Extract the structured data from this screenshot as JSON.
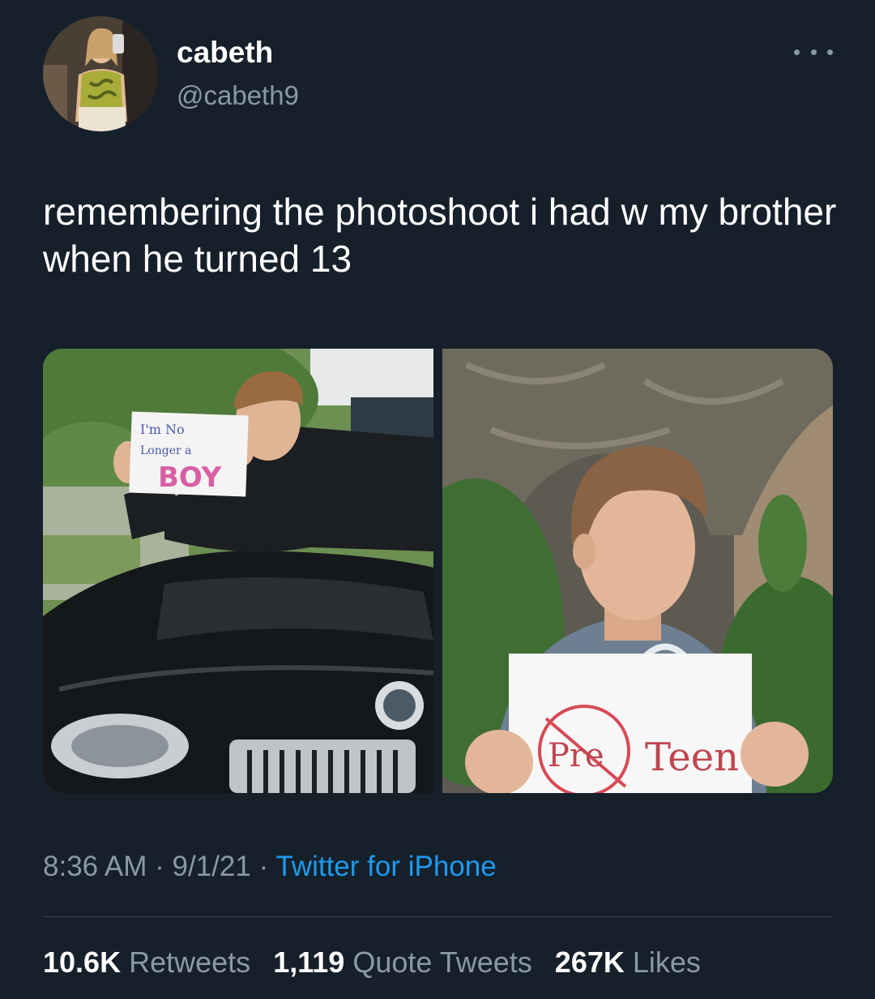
{
  "author": {
    "display_name": "cabeth",
    "handle": "@cabeth9",
    "avatar_icon": "profile-photo",
    "more_icon": "more-horizontal-icon"
  },
  "tweet": {
    "text": "remembering the photoshoot i had w my brother when he turned 13",
    "media": [
      {
        "sign_text": "I'm No Longer a BOY"
      },
      {
        "sign_text": "Pre Teen"
      }
    ],
    "time": "8:36 AM",
    "date": "9/1/21",
    "separator": "·",
    "source": "Twitter for iPhone"
  },
  "stats": {
    "retweets_count": "10.6K",
    "retweets_label": "Retweets",
    "quotes_count": "1,119",
    "quotes_label": "Quote Tweets",
    "likes_count": "267K",
    "likes_label": "Likes"
  },
  "colors": {
    "background": "#15202b",
    "secondary_text": "#8b98a5",
    "link": "#1d9bf0",
    "divider": "#38444d"
  }
}
